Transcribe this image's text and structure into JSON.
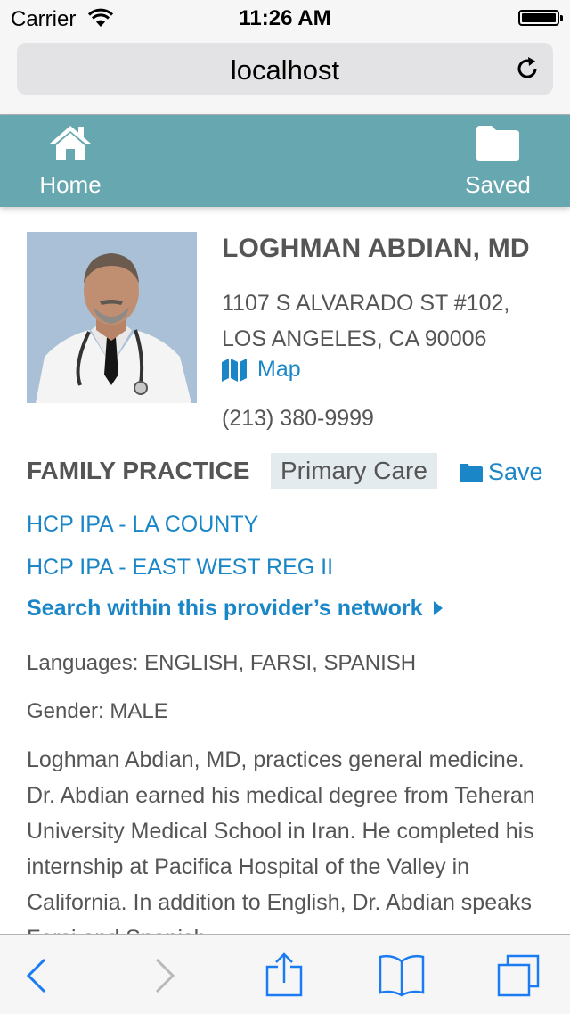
{
  "status_bar": {
    "carrier": "Carrier",
    "time": "11:26 AM"
  },
  "browser": {
    "url": "localhost"
  },
  "nav": {
    "home_label": "Home",
    "saved_label": "Saved"
  },
  "provider": {
    "name": "LOGHMAN ABDIAN, MD",
    "address_line1": "1107 S ALVARADO ST #102,",
    "address_line2": "LOS ANGELES, CA 90006",
    "map_label": "Map",
    "phone": "(213) 380-9999",
    "specialty": "FAMILY PRACTICE",
    "care_type": "Primary Care",
    "save_label": "Save",
    "networks": [
      "HCP IPA - LA COUNTY",
      "HCP IPA - EAST WEST REG II"
    ],
    "network_search_label": "Search within this provider’s network",
    "languages": "Languages: ENGLISH, FARSI, SPANISH",
    "gender": "Gender: MALE",
    "bio": "Loghman Abdian, MD, practices general medicine. Dr. Abdian earned his medical degree from Teheran University Medical School in Iran. He completed his internship at Pacifica Hospital of the Valley in California. In addition to English, Dr. Abdian speaks Farsi and Spanish."
  },
  "colors": {
    "nav_bg": "#67a7b0",
    "link": "#1a86c8",
    "text": "#555555",
    "badge_bg": "#e4ebef",
    "ios_blue": "#1a7cf0"
  },
  "icons": [
    "wifi-icon",
    "battery-icon",
    "reload-icon",
    "home-icon",
    "folder-icon",
    "map-icon",
    "caret-right-icon",
    "back-icon",
    "forward-icon",
    "share-icon",
    "bookmarks-icon",
    "tabs-icon"
  ]
}
